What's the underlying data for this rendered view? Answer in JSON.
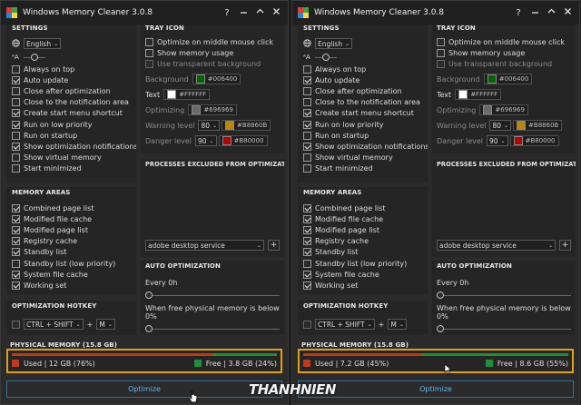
{
  "window_title": "Windows Memory Cleaner 3.0.8",
  "titlebar_buttons": {
    "help": "?",
    "minimize": "—"
  },
  "settings": {
    "header": "SETTINGS",
    "language": "English",
    "options": [
      {
        "label": "Always on top",
        "checked": false
      },
      {
        "label": "Auto update",
        "checked": true
      },
      {
        "label": "Close after optimization",
        "checked": false
      },
      {
        "label": "Close to the notification area",
        "checked": false
      },
      {
        "label": "Create start menu shortcut",
        "checked": true
      },
      {
        "label": "Run on low priority",
        "checked": true
      },
      {
        "label": "Run on startup",
        "checked": false
      },
      {
        "label": "Show optimization notifications",
        "checked": true
      },
      {
        "label": "Show virtual memory",
        "checked": false
      },
      {
        "label": "Start minimized",
        "checked": false
      }
    ]
  },
  "memory_areas": {
    "header": "MEMORY AREAS",
    "items": [
      {
        "label": "Combined page list",
        "checked": true
      },
      {
        "label": "Modified file cache",
        "checked": true
      },
      {
        "label": "Modified page list",
        "checked": true
      },
      {
        "label": "Registry cache",
        "checked": true
      },
      {
        "label": "Standby list",
        "checked": true
      },
      {
        "label": "Standby list (low priority)",
        "checked": false
      },
      {
        "label": "System file cache",
        "checked": true
      },
      {
        "label": "Working set",
        "checked": true
      }
    ]
  },
  "hotkey": {
    "header": "OPTIMIZATION HOTKEY",
    "modifier": "CTRL + SHIFT",
    "plus": "+",
    "key": "M"
  },
  "tray_icon": {
    "header": "TRAY ICON",
    "opt_middle": "Optimize on middle mouse click",
    "show_usage": "Show memory usage",
    "transparent": "Use transparent background",
    "background_label": "Background",
    "background_value": "#006400",
    "text_label": "Text",
    "text_value": "#FFFFFF",
    "optimizing_label": "Optimizing",
    "optimizing_value": "#696969",
    "warning_label": "Warning level",
    "warning_level": "80",
    "warning_value": "#B8860B",
    "danger_label": "Danger level",
    "danger_level": "90",
    "danger_value": "#B80000",
    "colors": {
      "background": "#006400",
      "text": "#FFFFFF",
      "optimizing": "#696969",
      "warning": "#B8860B",
      "danger": "#B80000"
    }
  },
  "processes": {
    "header": "PROCESSES EXCLUDED FROM OPTIMIZATION",
    "selected": "adobe desktop service",
    "add": "+"
  },
  "auto_opt": {
    "header": "AUTO OPTIMIZATION",
    "every": "Every 0h",
    "when_free": "When free physical memory is below 0%",
    "every_value": 0,
    "free_value": 0
  },
  "physical_memory": {
    "header": "PHYSICAL MEMORY (15.8 GB)",
    "used_color": "#c0391b",
    "free_color": "#1e8f3a"
  },
  "windows": [
    {
      "used_text": "Used | 12 GB (76%)",
      "free_text": "Free | 3.8 GB (24%)",
      "used_fraction": 0.76
    },
    {
      "used_text": "Used | 7.2 GB (45%)",
      "free_text": "Free | 8.6 GB (55%)",
      "used_fraction": 0.45
    }
  ],
  "optimize_label": "Optimize",
  "watermark": "THANHNIEN",
  "accent": {
    "highlight": "#E0A019",
    "button_text": "#5FB6EF"
  }
}
